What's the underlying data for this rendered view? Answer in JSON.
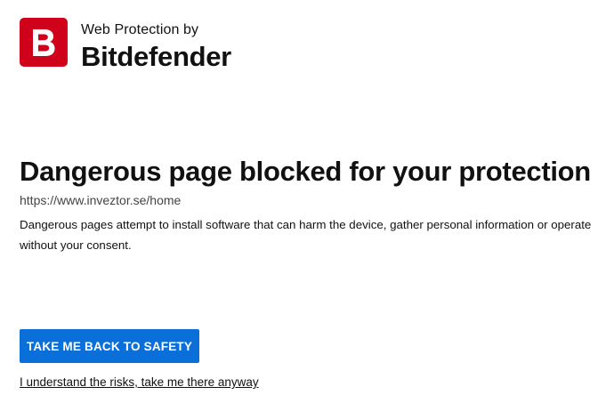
{
  "brand": {
    "logo_letter": "B",
    "logo_color": "#d0021b",
    "subtitle": "Web Protection by",
    "name": "Bitdefender"
  },
  "warning": {
    "headline": "Dangerous page blocked for your protection",
    "url": "https://www.inveztor.se/home",
    "description": "Dangerous pages attempt to install software that can harm the device, gather personal information or operate without your consent."
  },
  "actions": {
    "primary_label": "TAKE ME BACK TO SAFETY",
    "primary_color": "#0a6fd8",
    "risk_link_label": "I understand the risks, take me there anyway"
  }
}
